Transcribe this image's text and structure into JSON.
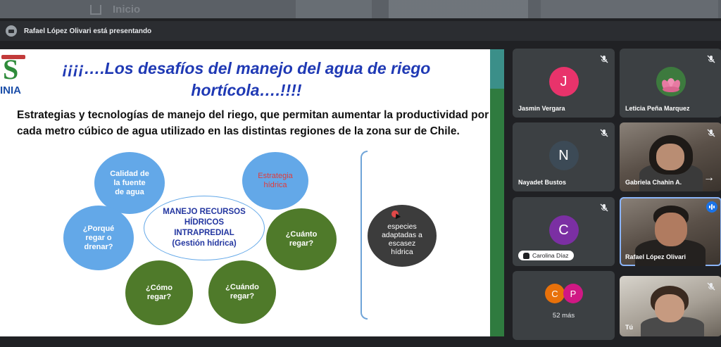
{
  "background_strip": {
    "faint_label": "Inicio"
  },
  "presenter_bar": {
    "text": "Rafael López Olivari está presentando"
  },
  "slide": {
    "logo_text": "INIA",
    "title_line1": "¡¡¡¡….Los desafíos del manejo del agua de riego",
    "title_line2": "hortícola….!!!!",
    "subtitle": "Estrategias y tecnologías de manejo del riego, que permitan aumentar la productividad por cada metro cúbico de agua utilizado en las distintas regiones de la zona sur de Chile.",
    "center_node": "MANEJO RECURSOS HÍDRICOS INTRAPREDIAL (Gestión hídrica)",
    "nodes": {
      "calidad": "Calidad de la fuente de agua",
      "estrategia": "Estrategia hídrica",
      "porque": "¿Porqué regar o drenar?",
      "cuanto": "¿Cuánto regar?",
      "como": "¿Cómo regar?",
      "cuando": "¿Cuándo regar?",
      "especies": "especies adaptadas a escasez hídrica"
    },
    "colors": {
      "title_blue": "#1f39b4",
      "node_blue": "#63a8e8",
      "node_green": "#4f7a2a",
      "accent_red": "#e03b3b"
    }
  },
  "participants": [
    {
      "name": "Jasmin Vergara",
      "initial": "J",
      "color": "#e8336b",
      "muted": true
    },
    {
      "name": "Leticia Peña Marquez",
      "avatar": "lotus-flower",
      "muted": true
    },
    {
      "name": "Nayadet Bustos",
      "initial": "N",
      "color": "#3c4a56",
      "muted": true
    },
    {
      "name": "Gabriela Chahin A.",
      "video": true,
      "muted": true
    },
    {
      "name": "Carolina Díaz",
      "initial": "C",
      "color": "#7b2fa3",
      "muted": true,
      "hand_raised": true
    },
    {
      "name": "Rafael López Olivari",
      "video": true,
      "speaking": true
    },
    {
      "more_count": "52 más",
      "initials": [
        "C",
        "P"
      ],
      "colors": [
        "#e8710a",
        "#d01884"
      ]
    },
    {
      "name": "Tú",
      "video": true,
      "muted": true
    }
  ]
}
